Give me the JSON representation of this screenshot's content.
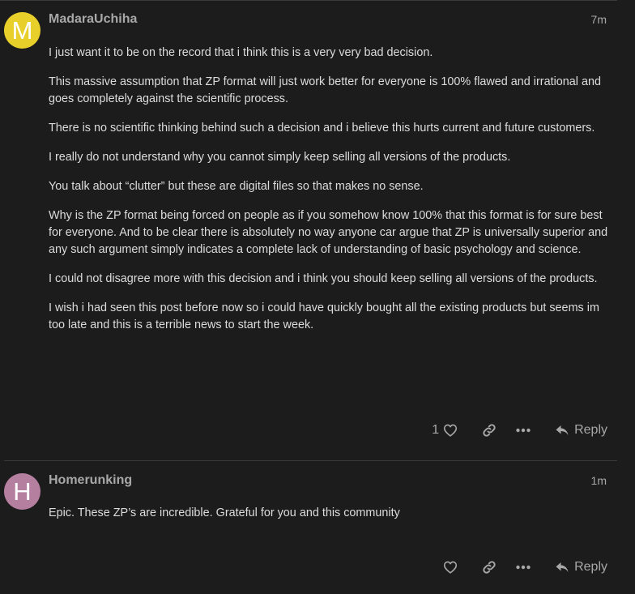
{
  "posts": [
    {
      "avatar_letter": "M",
      "avatar_color": "#e9cf2a",
      "username": "MadaraUchiha",
      "time": "7m",
      "paragraphs": [
        "I just want it to be on the record that i think this is a very very bad decision.",
        "This massive assumption that ZP format will just work better for everyone is 100% flawed and irrational and goes completely against the scientific process.",
        "There is no scientific thinking behind such a decision and i believe this hurts current and future customers.",
        "I really do not understand why you cannot simply keep selling all versions of the products.",
        "You talk about “clutter” but these are digital files so that makes no sense.",
        "Why is the ZP format being forced on people as if you somehow know 100% that this format is for sure best for everyone. And to be clear there is absolutely no way anyone car argue that ZP is universally superior and any such argument simply indicates a complete lack of understanding of basic psychology and science.",
        "I could not disagree more with this decision and i think you should keep selling all versions of the products.",
        "I wish i had seen this post before now so i could have quickly bought all the existing products but seems im too late and this is a terrible news to start the week."
      ],
      "like_count": "1",
      "reply_label": "Reply"
    },
    {
      "avatar_letter": "H",
      "avatar_color": "#b57fa0",
      "username": "Homerunking",
      "time": "1m",
      "paragraphs": [
        "Epic. These ZP’s are incredible. Grateful for you and this community"
      ],
      "like_count": "",
      "reply_label": "Reply"
    }
  ],
  "icons": {
    "like": "heart-icon",
    "share": "link-icon",
    "more": "ellipsis-icon",
    "reply": "reply-arrow-icon"
  }
}
